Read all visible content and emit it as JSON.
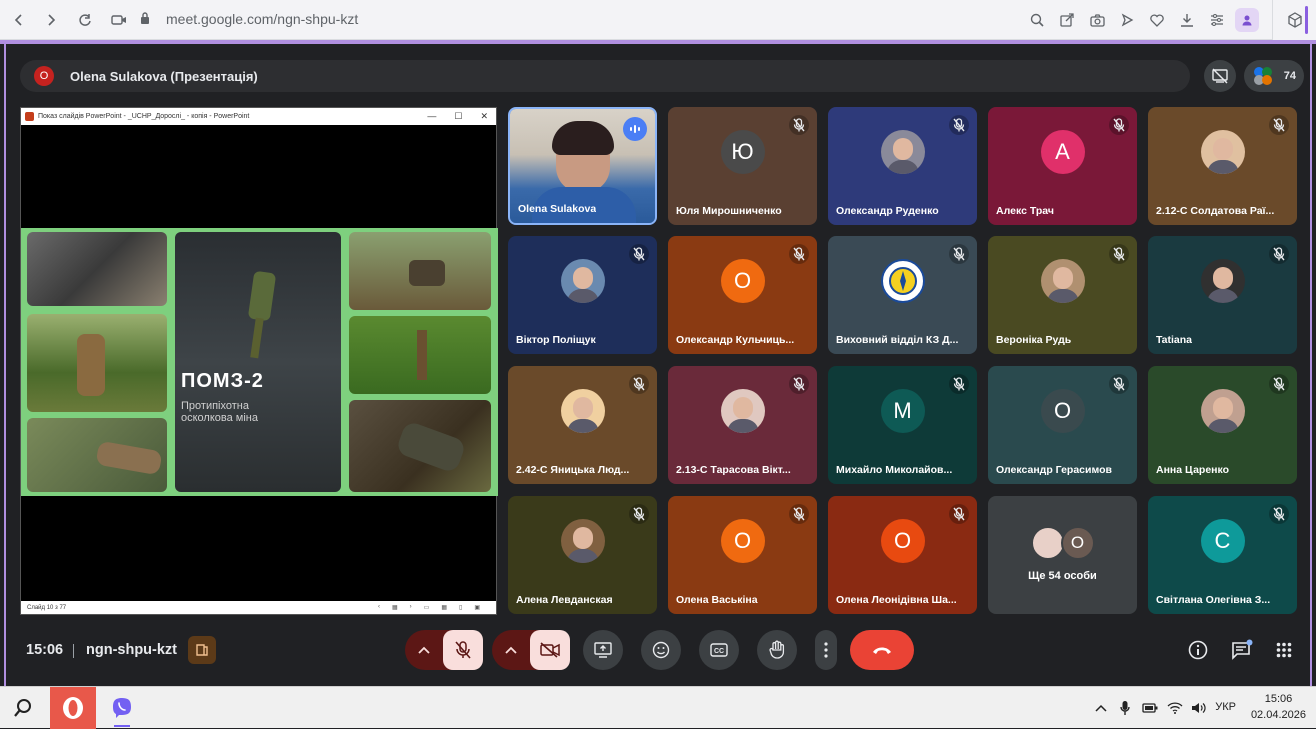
{
  "browser": {
    "url": "meet.google.com/ngn-shpu-kzt"
  },
  "meet": {
    "presenter_initial": "O",
    "presenter_title": "Olena Sulakova (Презентація)",
    "participant_count": "74"
  },
  "presentation": {
    "window_title": "Показ слайдів PowerPoint  -  _UCHP_Дорослі_ - копія - PowerPoint",
    "slide_title": "ПОМЗ-2",
    "slide_subtitle_1": "Протипіхотна",
    "slide_subtitle_2": "осколкова міна",
    "slide_counter": "Слайд 10 з 77"
  },
  "tiles": [
    {
      "name": "Olena Sulakova",
      "type": "video",
      "bg": "#4a6fa5",
      "speaking": true
    },
    {
      "name": "Юля Мирошниченко",
      "type": "letter",
      "initial": "Ю",
      "bg": "#5a4032",
      "avatar_bg": "#4a4a4a"
    },
    {
      "name": "Олександр Руденко",
      "type": "photo",
      "bg": "#2e3a7a",
      "avatar_bg": "#8a8a9a"
    },
    {
      "name": "Алекс Трач",
      "type": "letter",
      "initial": "А",
      "bg": "#7a1838",
      "avatar_bg": "#e0306a"
    },
    {
      "name": "2.12-С Солдатова Раї...",
      "type": "photo",
      "bg": "#6a4a2a",
      "avatar_bg": "#e0c0a0"
    },
    {
      "name": "Віктор Поліщук",
      "type": "photo",
      "bg": "#1e2e5a",
      "avatar_bg": "#6a8ab0"
    },
    {
      "name": "Олександр Кульчиць...",
      "type": "letter",
      "initial": "О",
      "bg": "#8a3a12",
      "avatar_bg": "#f06a10"
    },
    {
      "name": "Виховний відділ КЗ Д...",
      "type": "logo",
      "bg": "#3a4a55",
      "avatar_bg": "#ffffff"
    },
    {
      "name": "Вероніка Рудь",
      "type": "photo",
      "bg": "#4a4a22",
      "avatar_bg": "#b09070"
    },
    {
      "name": "Tatiana",
      "type": "photo",
      "bg": "#1a3a40",
      "avatar_bg": "#303030"
    },
    {
      "name": "2.42-С Яницька Люд...",
      "type": "photo",
      "bg": "#6a4a2a",
      "avatar_bg": "#f0d0a0"
    },
    {
      "name": "2.13-С Тарасова Вікт...",
      "type": "photo",
      "bg": "#6a2a3a",
      "avatar_bg": "#e0c8c0"
    },
    {
      "name": "Михайло Миколайов...",
      "type": "letter",
      "initial": "М",
      "bg": "#0e3a38",
      "avatar_bg": "#0e5a55"
    },
    {
      "name": "Олександр Герасимов",
      "type": "letter",
      "initial": "О",
      "bg": "#2a4a4e",
      "avatar_bg": "#3a4a4e"
    },
    {
      "name": "Анна Царенко",
      "type": "photo",
      "bg": "#2a4a2a",
      "avatar_bg": "#c0a090"
    },
    {
      "name": "Алена Левданская",
      "type": "photo",
      "bg": "#3a3a1a",
      "avatar_bg": "#806040"
    },
    {
      "name": "Олена Васькіна",
      "type": "letter",
      "initial": "О",
      "bg": "#8a3a12",
      "avatar_bg": "#f06a10"
    },
    {
      "name": "Олена Леонідівна Ша...",
      "type": "letter",
      "initial": "О",
      "bg": "#8a2a12",
      "avatar_bg": "#e84a10"
    },
    {
      "name": "more",
      "type": "more",
      "bg": "#3c4043",
      "label": "Ще 54 особи",
      "initial": "О"
    },
    {
      "name": "Світлана Олегівна З...",
      "type": "letter",
      "initial": "С",
      "bg": "#0e4a4a",
      "avatar_bg": "#0e9a9a"
    }
  ],
  "bottom": {
    "time": "15:06",
    "meeting_code": "ngn-shpu-kzt"
  },
  "taskbar": {
    "time": "15:06",
    "date": "02.04.2026",
    "lang": "УКР"
  }
}
